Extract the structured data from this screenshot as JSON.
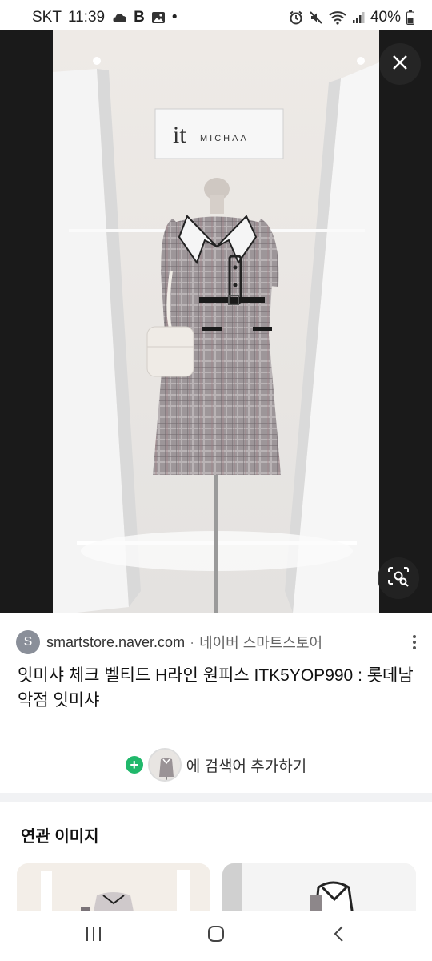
{
  "status_bar": {
    "carrier": "SKT",
    "time": "11:39",
    "extra_letter": "B",
    "dot": "•",
    "battery": "40%"
  },
  "viewer": {
    "brand_sign": {
      "logo_text": "it",
      "brand_text": "MICHAA"
    }
  },
  "result": {
    "favicon_letter": "S",
    "domain": "smartstore.naver.com",
    "separator": "·",
    "site_name": "네이버 스마트스토어",
    "title": "잇미샤 체크 벨티드 H라인 원피스 ITK5YOP990 : 롯데남악점 잇미샤"
  },
  "add_to_search": {
    "label": "에 검색어 추가하기"
  },
  "related": {
    "heading": "연관 이미지"
  },
  "colors": {
    "accent_green": "#20b86b",
    "viewer_bg": "#1a1a1a"
  },
  "icons": [
    "cloud-icon",
    "gallery-icon",
    "alarm-icon",
    "mute-icon",
    "wifi-icon",
    "signal-icon",
    "battery-icon",
    "close-icon",
    "lens-search-icon",
    "more-vert-icon",
    "plus-icon",
    "recents-icon",
    "home-icon",
    "back-icon"
  ]
}
